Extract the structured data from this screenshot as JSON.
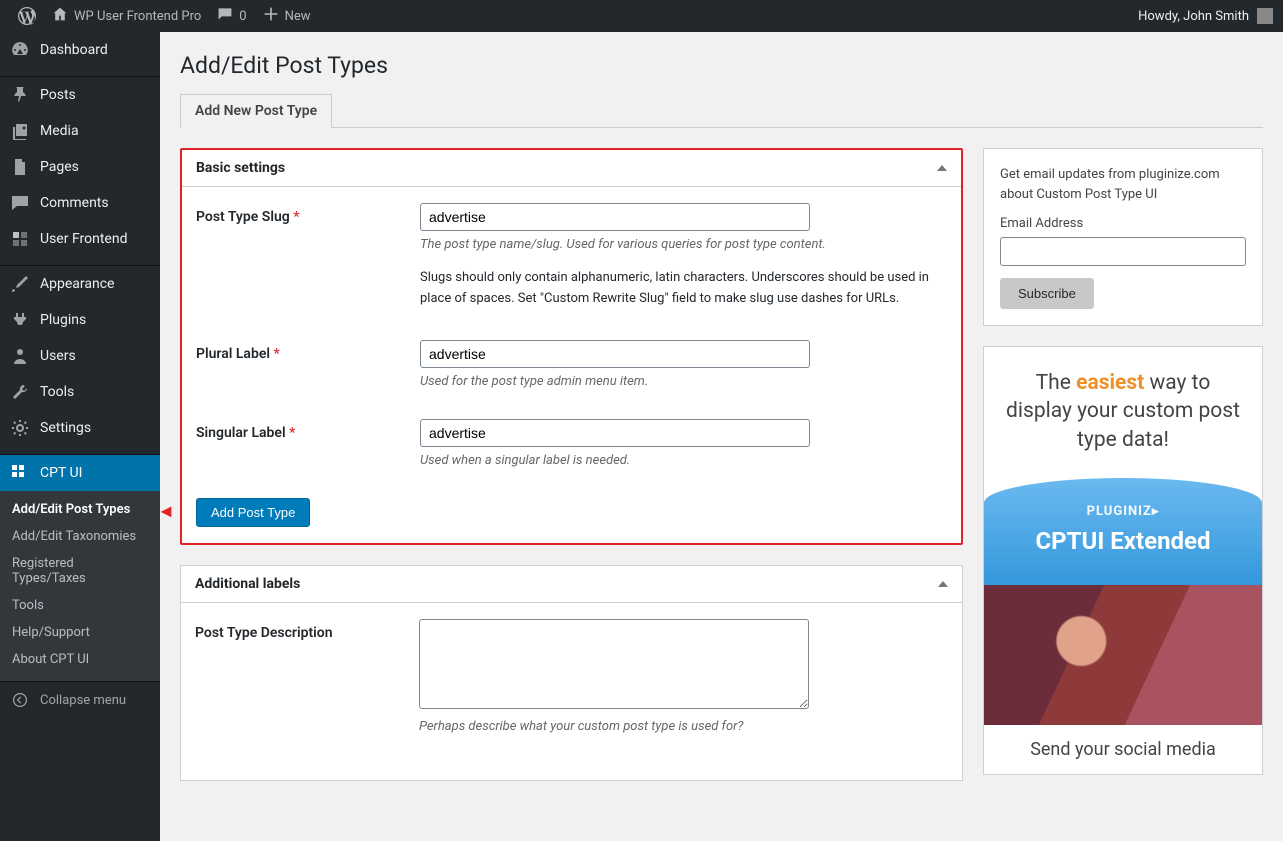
{
  "adminbar": {
    "site_name": "WP User Frontend Pro",
    "comments_count": "0",
    "new_label": "New",
    "howdy": "Howdy, John Smith"
  },
  "sidebar": {
    "items": [
      {
        "label": "Dashboard",
        "icon": "dash"
      },
      {
        "sep": true
      },
      {
        "label": "Posts",
        "icon": "pin"
      },
      {
        "label": "Media",
        "icon": "media"
      },
      {
        "label": "Pages",
        "icon": "page"
      },
      {
        "label": "Comments",
        "icon": "comment"
      },
      {
        "label": "User Frontend",
        "icon": "wpuf"
      },
      {
        "sep": true
      },
      {
        "label": "Appearance",
        "icon": "brush"
      },
      {
        "label": "Plugins",
        "icon": "plug"
      },
      {
        "label": "Users",
        "icon": "user"
      },
      {
        "label": "Tools",
        "icon": "wrench"
      },
      {
        "label": "Settings",
        "icon": "gear"
      },
      {
        "sep": true
      },
      {
        "label": "CPT UI",
        "icon": "cptui",
        "current": true
      }
    ],
    "submenu": [
      {
        "label": "Add/Edit Post Types",
        "current": true,
        "arrow": true
      },
      {
        "label": "Add/Edit Taxonomies"
      },
      {
        "label": "Registered Types/Taxes"
      },
      {
        "label": "Tools"
      },
      {
        "label": "Help/Support"
      },
      {
        "label": "About CPT UI"
      }
    ],
    "collapse_label": "Collapse menu"
  },
  "page": {
    "title": "Add/Edit Post Types",
    "tab": "Add New Post Type"
  },
  "basic": {
    "heading": "Basic settings",
    "slug": {
      "label": "Post Type Slug",
      "value": "advertise",
      "help": "The post type name/slug. Used for various queries for post type content.",
      "extra": "Slugs should only contain alphanumeric, latin characters. Underscores should be used in place of spaces. Set \"Custom Rewrite Slug\" field to make slug use dashes for URLs."
    },
    "plural": {
      "label": "Plural Label",
      "value": "advertise",
      "help": "Used for the post type admin menu item."
    },
    "singular": {
      "label": "Singular Label",
      "value": "advertise",
      "help": "Used when a singular label is needed."
    },
    "submit": "Add Post Type"
  },
  "additional": {
    "heading": "Additional labels",
    "desc": {
      "label": "Post Type Description",
      "value": "",
      "help": "Perhaps describe what your custom post type is used for?"
    }
  },
  "side": {
    "newsletter": {
      "text": "Get email updates from pluginize.com about Custom Post Type UI",
      "email_label": "Email Address",
      "subscribe": "Subscribe"
    },
    "promo": {
      "line1_a": "The ",
      "line1_b": "easiest",
      "line1_c": " way to display your custom post type data!",
      "brand": "PLUGINIZ▸",
      "product": "CPTUI Extended",
      "tag": "Send your social media"
    }
  }
}
